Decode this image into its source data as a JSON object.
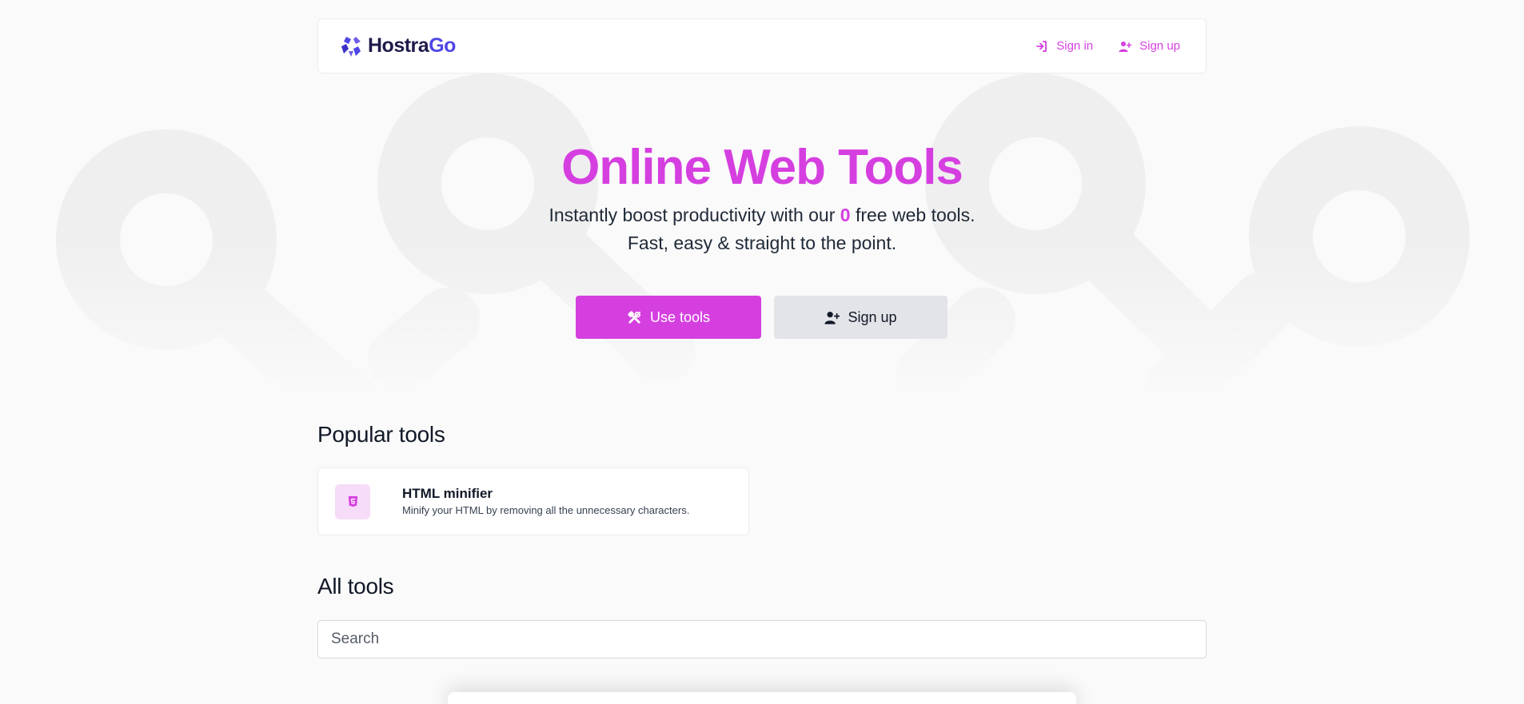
{
  "navbar": {
    "brand_main": "Hostra",
    "brand_accent": "Go",
    "signin_label": "Sign in",
    "signup_label": "Sign up"
  },
  "hero": {
    "title": "Online Web Tools",
    "subtitle_before": "Instantly boost productivity with our ",
    "tool_count": "0",
    "subtitle_after": " free web tools.",
    "subtitle_line2": "Fast, easy & straight to the point.",
    "primary_button": "Use tools",
    "secondary_button": "Sign up"
  },
  "popular": {
    "title": "Popular tools",
    "tools": [
      {
        "name": "HTML minifier",
        "description": "Minify your HTML by removing all the unnecessary characters.",
        "icon": "html5-icon"
      }
    ]
  },
  "all_tools": {
    "title": "All tools",
    "search_placeholder": "Search"
  },
  "colors": {
    "accent": "#d53fe0",
    "brand_indigo": "#4f46e5",
    "background": "#fafafa",
    "secondary_button": "#e2e4e8"
  },
  "icons": {
    "brand": "hostrago-logo-icon",
    "signin": "sign-in-icon",
    "signup": "user-plus-icon",
    "use_tools": "tools-icon",
    "pattern": "magnifier-pattern-icon"
  }
}
